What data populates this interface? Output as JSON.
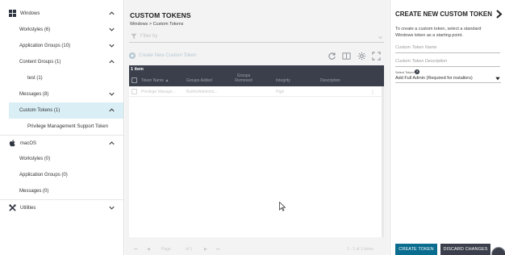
{
  "sidebar": {
    "windows": {
      "label": "Windows",
      "icon": "windows-logo-icon"
    },
    "items": [
      {
        "label": "Workstyles (6)"
      },
      {
        "label": "Application Groups (10)"
      },
      {
        "label": "Content Groups (1)"
      },
      {
        "label": "test (1)"
      },
      {
        "label": "Messages (8)"
      },
      {
        "label": "Custom Tokens (1)"
      },
      {
        "label": "Privilege Management Support Token"
      }
    ],
    "macos": {
      "label": "macOS",
      "icon": "apple-logo-icon"
    },
    "mac_items": [
      {
        "label": "Workstyles (0)"
      },
      {
        "label": "Application Groups (0)"
      },
      {
        "label": "Messages (0)"
      }
    ],
    "utilities": {
      "label": "Utilities",
      "icon": "utilities-tools-icon"
    }
  },
  "main": {
    "title": "CUSTOM TOKENS",
    "breadcrumb": "Windows > Custom Tokens",
    "filter_placeholder": "Filter by",
    "create_label": "Create New Custom Token",
    "grid": {
      "count": "1 item",
      "columns": [
        "Token Name ▲",
        "Groups Added",
        "Groups Removed",
        "Integrity",
        "Description"
      ],
      "rows": [
        {
          "name": "Privilege Manage...",
          "groups_added": "Builtin\\Administ...",
          "groups_removed": "",
          "integrity": "High",
          "description": ""
        }
      ]
    },
    "pager": {
      "page_label": "Page",
      "of_label": "of 1",
      "summary": "1 - 1 of 1 items"
    }
  },
  "panel": {
    "title": "CREATE NEW CUSTOM TOKEN",
    "description": "To create a custom token, select a standard Windows token as a starting point.",
    "name_placeholder": "Custom Token Name",
    "desc_placeholder": "Custom Token Description",
    "select_label": "Select Token*",
    "select_value": "Add Full Admin (Required for installers)",
    "create_button": "CREATE TOKEN",
    "discard_button": "DISCARD CHANGES"
  },
  "colors": {
    "accent": "#0a6c8e",
    "dark": "#3a3f4b",
    "selected_bg": "#d9eef5"
  }
}
